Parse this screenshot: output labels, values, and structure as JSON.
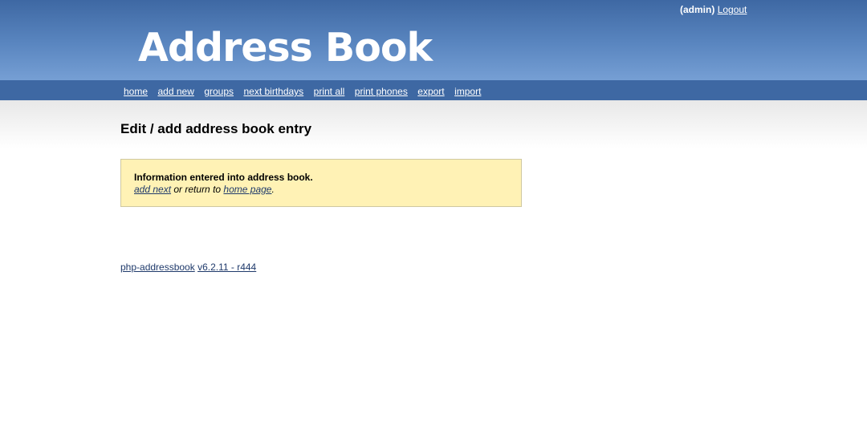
{
  "header": {
    "user": "(admin)",
    "logout_label": "Logout",
    "logo_text": "Address Book"
  },
  "nav": {
    "items": [
      {
        "label": "home"
      },
      {
        "label": "add new"
      },
      {
        "label": "groups"
      },
      {
        "label": "next birthdays"
      },
      {
        "label": "print all"
      },
      {
        "label": "print phones"
      },
      {
        "label": "export"
      },
      {
        "label": "import"
      }
    ]
  },
  "main": {
    "title": "Edit / add address book entry",
    "message": {
      "title": "Information entered into address book.",
      "add_next_label": "add next",
      "middle_text": " or return to ",
      "home_page_label": "home page",
      "end_text": "."
    }
  },
  "footer": {
    "app_name": "php-addressbook",
    "version": "v6.2.11 - r444"
  },
  "colors": {
    "header_top": "#3e68a3",
    "header_bottom": "#769fd4",
    "nav_bg": "#3e68a3",
    "message_bg": "#fff2b5",
    "link": "#1f3a6b"
  }
}
